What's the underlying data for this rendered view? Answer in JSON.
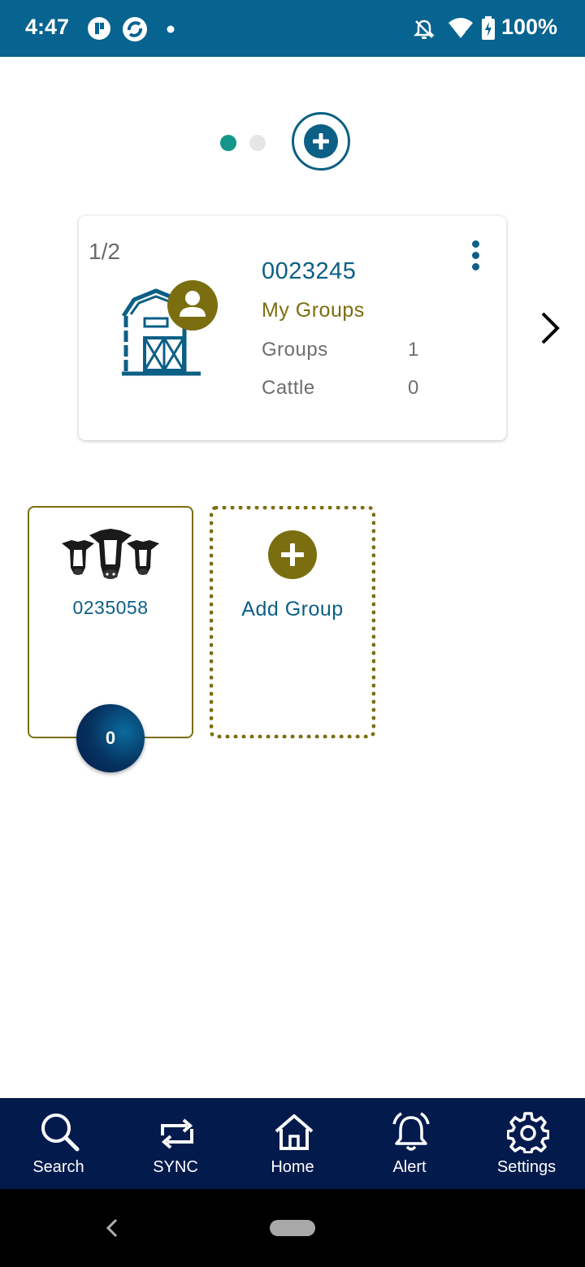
{
  "status_bar": {
    "time": "4:47",
    "battery": "100%",
    "background": "#07638f",
    "icons": [
      "app-notification-icon",
      "sync-notification-icon",
      "dot-icon",
      "do-not-disturb-icon",
      "wifi-icon",
      "battery-charging-icon"
    ]
  },
  "pager": {
    "pages": 2,
    "active_page": 1,
    "add_icon": "plus-circle-icon"
  },
  "farm_card": {
    "counter": "1/2",
    "id": "0023245",
    "title": "My Groups",
    "stats": [
      {
        "label": "Groups",
        "value": "1"
      },
      {
        "label": "Cattle",
        "value": "0"
      }
    ],
    "icon": "barn-user-icon",
    "menu_icon": "kebab-menu-icon",
    "next_icon": "chevron-right-icon"
  },
  "groups": [
    {
      "id": "0235058",
      "cattle_count": "0",
      "icon": "cows-icon"
    }
  ],
  "add_group": {
    "label": "Add Group",
    "icon": "plus-circle-icon"
  },
  "bottom_nav": {
    "background": "#031a4d",
    "items": [
      {
        "label": "Search",
        "icon": "search-icon"
      },
      {
        "label": "SYNC",
        "icon": "sync-icon"
      },
      {
        "label": "Home",
        "icon": "home-icon"
      },
      {
        "label": "Alert",
        "icon": "alert-bell-icon"
      },
      {
        "label": "Settings",
        "icon": "gear-icon"
      }
    ]
  },
  "colors": {
    "primary_blue": "#0c5f85",
    "olive": "#7b6e10",
    "teal_dot": "#14968a",
    "gray_text": "#6e6e6e"
  }
}
